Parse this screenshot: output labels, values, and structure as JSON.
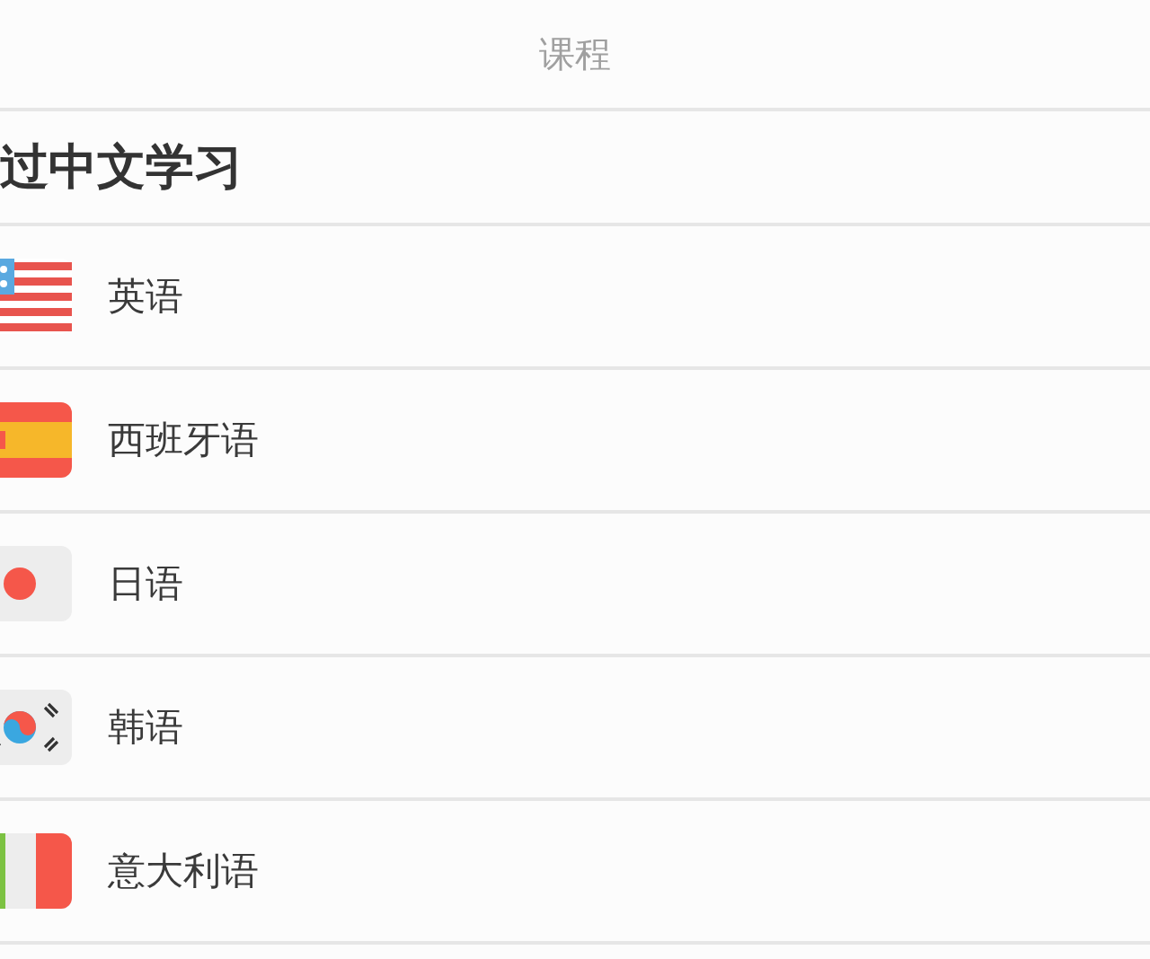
{
  "header": {
    "title": "课程"
  },
  "section": {
    "title": "过中文学习"
  },
  "courses": [
    {
      "kind": "us",
      "name": "英语"
    },
    {
      "kind": "es",
      "name": "西班牙语"
    },
    {
      "kind": "jp",
      "name": "日语"
    },
    {
      "kind": "kr",
      "name": "韩语"
    },
    {
      "kind": "it",
      "name": "意大利语"
    }
  ]
}
